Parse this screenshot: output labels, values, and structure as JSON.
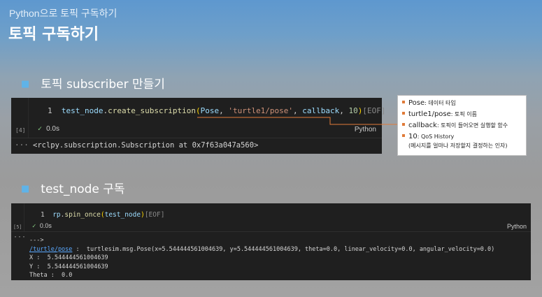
{
  "header": {
    "breadcrumb": "Python으로 토픽 구독하기",
    "title": "토픽 구독하기"
  },
  "bullets": [
    "토픽 subscriber 만들기",
    "test_node 구독"
  ],
  "cell1": {
    "exec_count": "[4]",
    "line_no": "1",
    "code": {
      "obj": "test_node",
      "dot": ".",
      "method": "create_subscription",
      "open": "(",
      "arg1": "Pose",
      "sep1": ", ",
      "arg2": "'turtle1/pose'",
      "sep2": ", ",
      "arg3": "callback",
      "sep3": ", ",
      "arg4": "10",
      "close": ")",
      "eof": "[EOF]"
    },
    "status_check": "✓",
    "status_time": "0.0s",
    "language": "Python",
    "output_marker": "···",
    "output": "<rclpy.subscription.Subscription at 0x7f63a047a560>"
  },
  "callout": {
    "items": [
      {
        "key": "Pose",
        "desc": ": 데이터 타입"
      },
      {
        "key": "turtle1/pose",
        "desc": ": 토픽 이름"
      },
      {
        "key": "callback",
        "desc": ": 토픽이 들어오면 실행할 함수"
      },
      {
        "key": "10",
        "desc": ": QoS History"
      }
    ],
    "note": "(메시지를 얼마나 저장할지 결정하는 인자)"
  },
  "cell2": {
    "exec_count": "[5]",
    "line_no": "1",
    "code": {
      "obj": "rp",
      "dot": ".",
      "method": "spin_once",
      "open": "(",
      "arg1": "test_node",
      "close": ")",
      "eof": "[EOF]"
    },
    "status_check": "✓",
    "status_time": "0.0s",
    "language": "Python",
    "output_marker": "···",
    "output_lines": {
      "arrow": "--->",
      "topic": "/turtle/pose",
      "pose_msg": " :  turtlesim.msg.Pose(x=5.544444561004639, y=5.544444561004639, theta=0.0, linear_velocity=0.0, angular_velocity=0.0)",
      "x": "X :  5.544444561004639",
      "y": "Y :  5.544444561004639",
      "theta": "Theta :  0.0"
    }
  }
}
